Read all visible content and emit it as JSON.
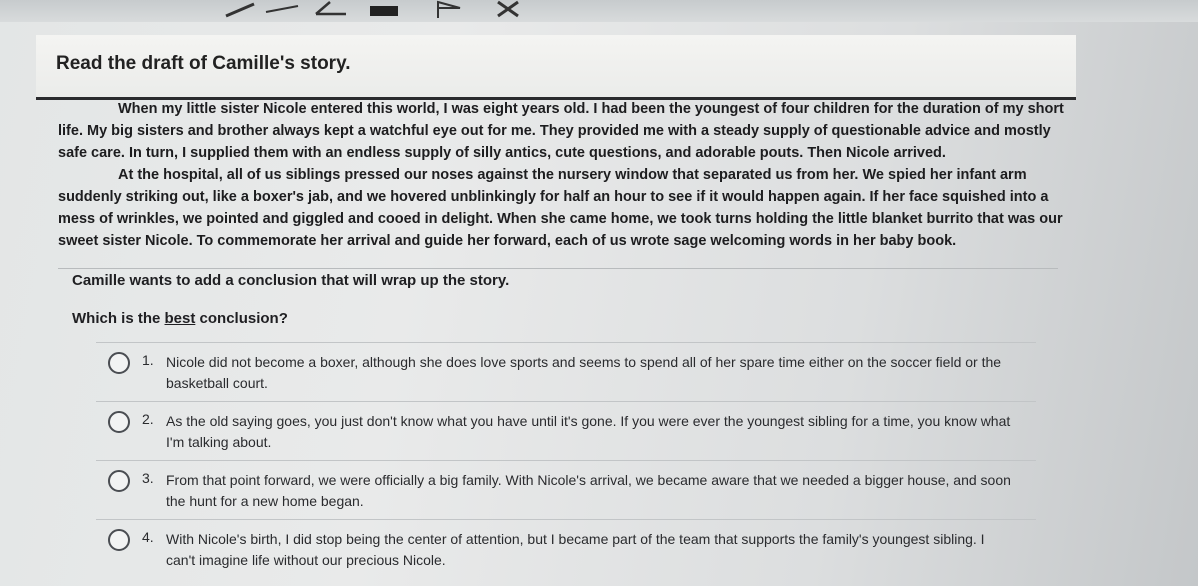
{
  "toolbar": {
    "icons": [
      "pencil-icon",
      "line-icon",
      "highlighter-icon",
      "eraser-icon",
      "flag-icon",
      "cross-out-icon"
    ]
  },
  "banner": {
    "title": "Read the draft of Camille's story."
  },
  "story": {
    "p1": "When my little sister Nicole entered this world, I was eight years old. I had been the youngest of four children for the duration of my short life. My big sisters and brother always kept a watchful eye out for me. They provided me with a steady supply of questionable advice and mostly safe care. In turn, I supplied them with an endless supply of silly antics, cute questions, and adorable pouts. Then Nicole arrived.",
    "p2": "At the hospital, all of us siblings pressed our noses against the nursery window that separated us from her. We spied her infant arm suddenly striking out, like a boxer's jab, and we hovered unblinkingly for half an hour to see if it would happen again. If her face squished into a mess of wrinkles, we pointed and giggled and cooed in delight. When she came home, we took turns holding the little blanket burrito that was our sweet sister Nicole. To commemorate her arrival and guide her forward, each of us wrote sage welcoming words in her baby book."
  },
  "question": {
    "intro": "Camille wants to add a conclusion that will wrap up the story.",
    "prompt_before": "Which is the ",
    "prompt_emph": "best",
    "prompt_after": " conclusion?"
  },
  "options": [
    {
      "num": "1.",
      "text": "Nicole did not become a boxer, although she does love sports and seems to spend all of her spare time either on the soccer field or the basketball court."
    },
    {
      "num": "2.",
      "text": "As the old saying goes, you just don't know what you have until it's gone. If you were ever the youngest sibling for a time, you know what I'm talking about."
    },
    {
      "num": "3.",
      "text": "From that point forward, we were officially a big family. With Nicole's arrival, we became aware that we needed a bigger house, and soon the hunt for a new home began."
    },
    {
      "num": "4.",
      "text": "With Nicole's birth, I did stop being the center of attention, but I became part of the team that supports the family's youngest sibling. I can't imagine life without our precious Nicole."
    }
  ]
}
